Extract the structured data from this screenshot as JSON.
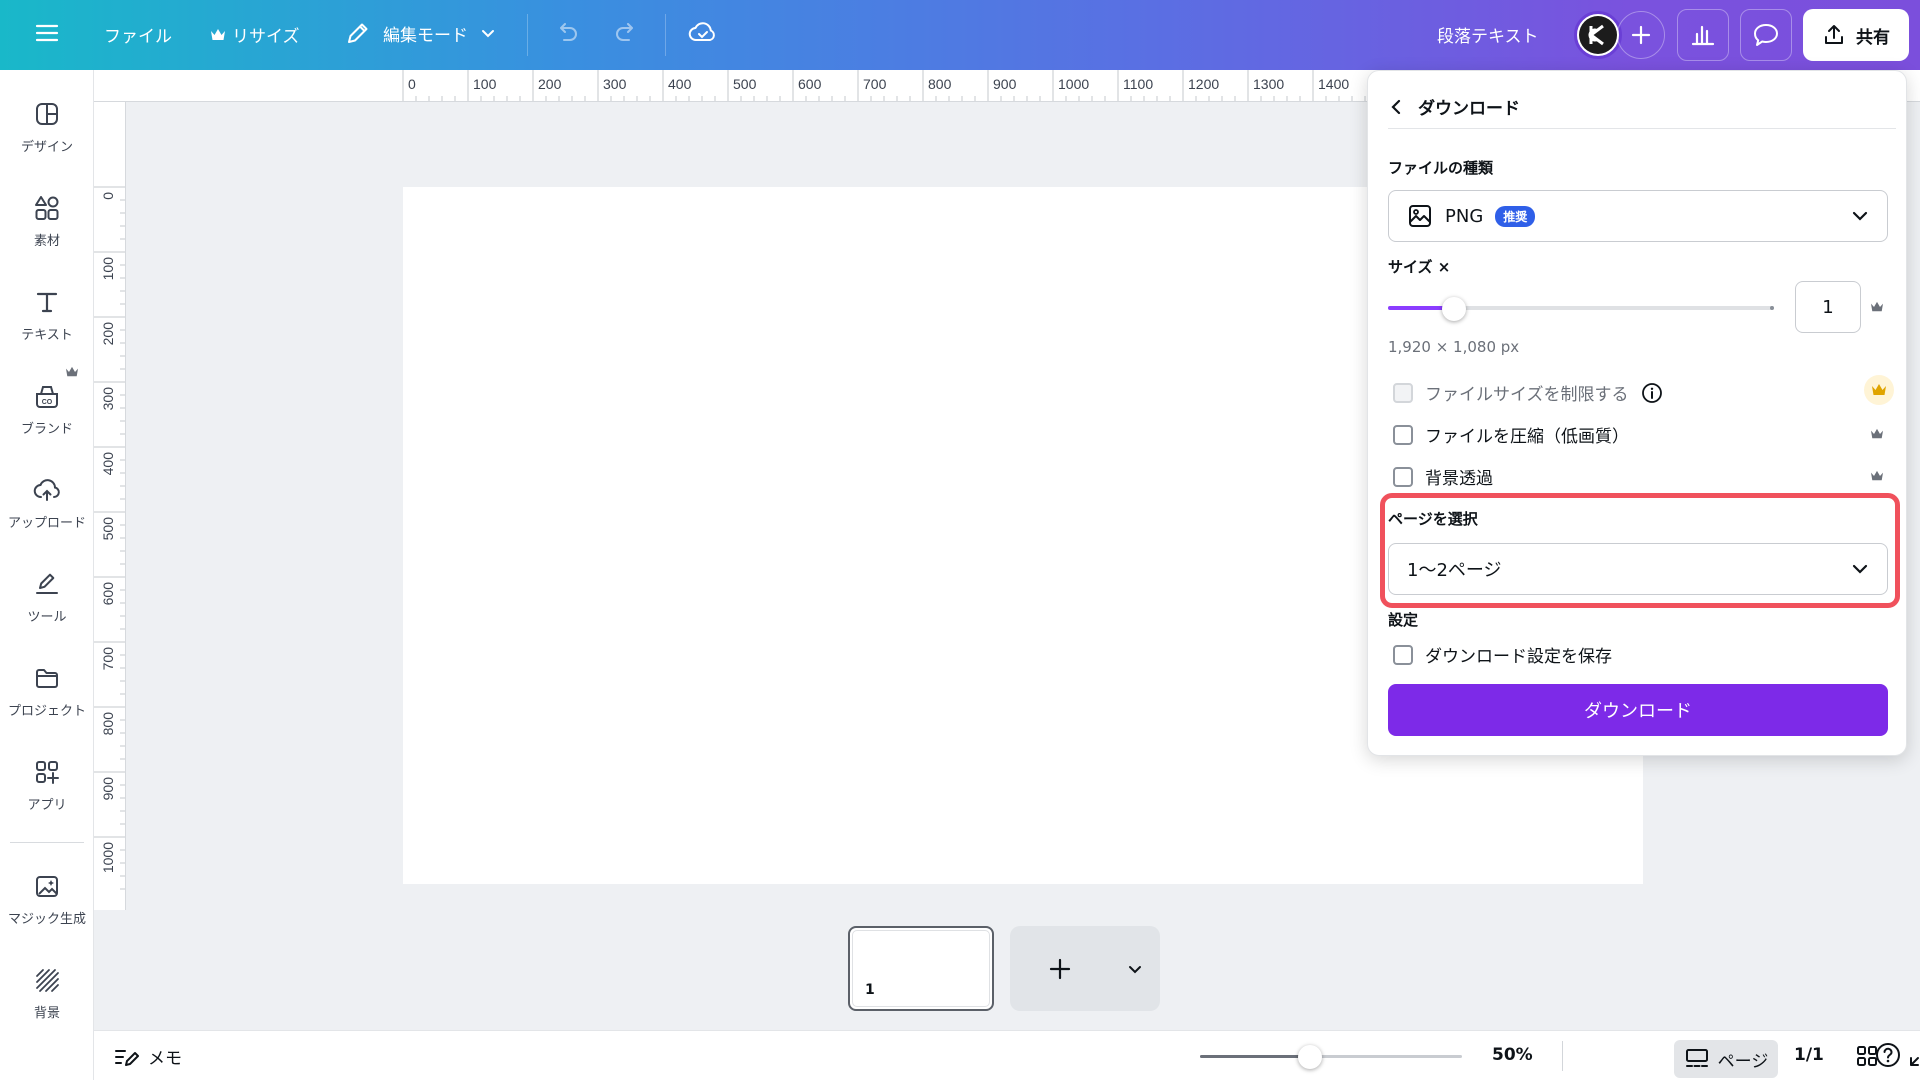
{
  "topbar": {
    "file_label": "ファイル",
    "resize_label": "リサイズ",
    "edit_mode_label": "編集モード",
    "text_type_label": "段落テキスト",
    "share_label": "共有"
  },
  "sidebar": {
    "items": [
      {
        "label": "デザイン",
        "icon": "layout-icon"
      },
      {
        "label": "素材",
        "icon": "shapes-icon"
      },
      {
        "label": "テキスト",
        "icon": "text-icon"
      },
      {
        "label": "ブランド",
        "icon": "brand-icon"
      },
      {
        "label": "アップロード",
        "icon": "cloud-upload-icon"
      },
      {
        "label": "ツール",
        "icon": "pen-tool-icon"
      },
      {
        "label": "プロジェクト",
        "icon": "folder-icon"
      },
      {
        "label": "アプリ",
        "icon": "apps-icon"
      },
      {
        "label": "マジック生成",
        "icon": "magic-image-icon"
      },
      {
        "label": "背景",
        "icon": "background-pattern-icon"
      }
    ]
  },
  "ruler": {
    "top": [
      "0",
      "100",
      "200",
      "300",
      "400",
      "500",
      "600",
      "700",
      "800",
      "900",
      "1000",
      "1100",
      "1200",
      "1300",
      "1400"
    ],
    "left": [
      "0",
      "100",
      "200",
      "300",
      "400",
      "500",
      "600",
      "700",
      "800",
      "900",
      "1000"
    ]
  },
  "pages": {
    "thumb_number": "1"
  },
  "bottombar": {
    "notes_label": "メモ",
    "zoom_value": "50%",
    "zoom_fraction": 0.42,
    "page_view_label": "ページ",
    "page_count": "1/1"
  },
  "download_panel": {
    "title": "ダウンロード",
    "file_type_label": "ファイルの種類",
    "file_type_value": "PNG",
    "file_type_badge": "推奨",
    "size_label": "サイズ ×",
    "size_value": "1",
    "size_slider_fraction": 0.17,
    "dimensions_text": "1,920 × 1,080 px",
    "limit_size_label": "ファイルサイズを制限する",
    "compress_label": "ファイルを圧縮（低画質）",
    "transparent_label": "背景透過",
    "select_pages_label": "ページを選択",
    "select_pages_value": "1〜2ページ",
    "settings_label": "設定",
    "save_settings_label": "ダウンロード設定を保存",
    "download_button": "ダウンロード"
  },
  "colors": {
    "accent_purple": "#7d2ae8",
    "slider_purple": "#8b3dff",
    "highlight_red": "#f0515c",
    "badge_blue": "#2f5fe8"
  }
}
